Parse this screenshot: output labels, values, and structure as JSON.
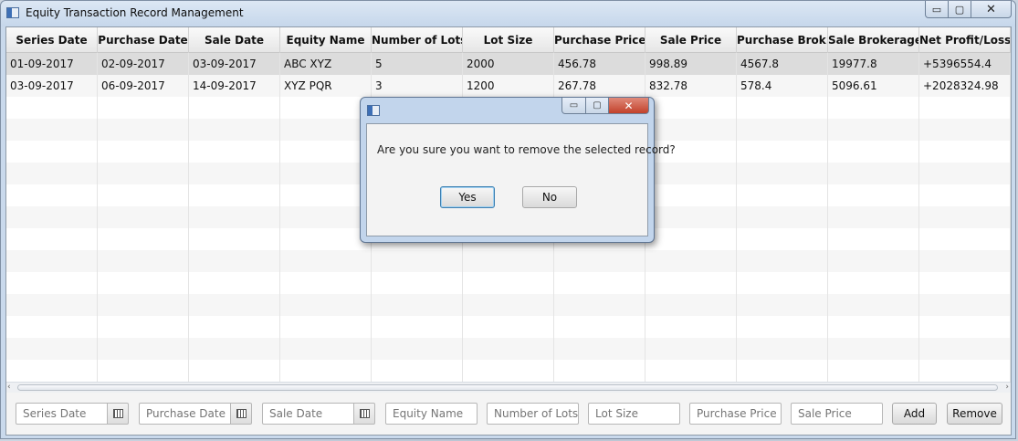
{
  "window": {
    "title": "Equity Transaction Record Management",
    "controls": {
      "minimize": "▭",
      "maximize": "▢",
      "close": "✕"
    }
  },
  "table": {
    "columns": [
      "Series Date",
      "Purchase Date",
      "Sale Date",
      "Equity Name",
      "Number of Lots",
      "Lot Size",
      "Purchase Price",
      "Sale Price",
      "Purchase Brok...",
      "Sale Brokerage",
      "Net Profit/Loss"
    ],
    "rows": [
      [
        "01-09-2017",
        "02-09-2017",
        "03-09-2017",
        "ABC XYZ",
        "5",
        "2000",
        "456.78",
        "998.89",
        "4567.8",
        "19977.8",
        "+5396554.4"
      ],
      [
        "03-09-2017",
        "06-09-2017",
        "14-09-2017",
        "XYZ PQR",
        "3",
        "1200",
        "267.78",
        "832.78",
        "578.4",
        "5096.61",
        "+2028324.98"
      ]
    ],
    "selected_row": 0
  },
  "scrollbar": {
    "left_arrow": "‹",
    "right_arrow": "›"
  },
  "form": {
    "series_date_placeholder": "Series Date",
    "purchase_date_placeholder": "Purchase Date",
    "sale_date_placeholder": "Sale Date",
    "equity_name_placeholder": "Equity Name",
    "number_of_lots_placeholder": "Number of Lots",
    "lot_size_placeholder": "Lot Size",
    "purchase_price_placeholder": "Purchase Price",
    "sale_price_placeholder": "Sale Price",
    "add_label": "Add",
    "remove_label": "Remove"
  },
  "dialog": {
    "message": "Are you sure you want to remove the selected record?",
    "yes_label": "Yes",
    "no_label": "No",
    "controls": {
      "minimize": "▭",
      "maximize": "▢",
      "close": "✕"
    }
  },
  "colors": {
    "selected_row": "#dcdcdc",
    "dialog_close": "#c2412b",
    "window_frame": "#c9d9ec"
  }
}
